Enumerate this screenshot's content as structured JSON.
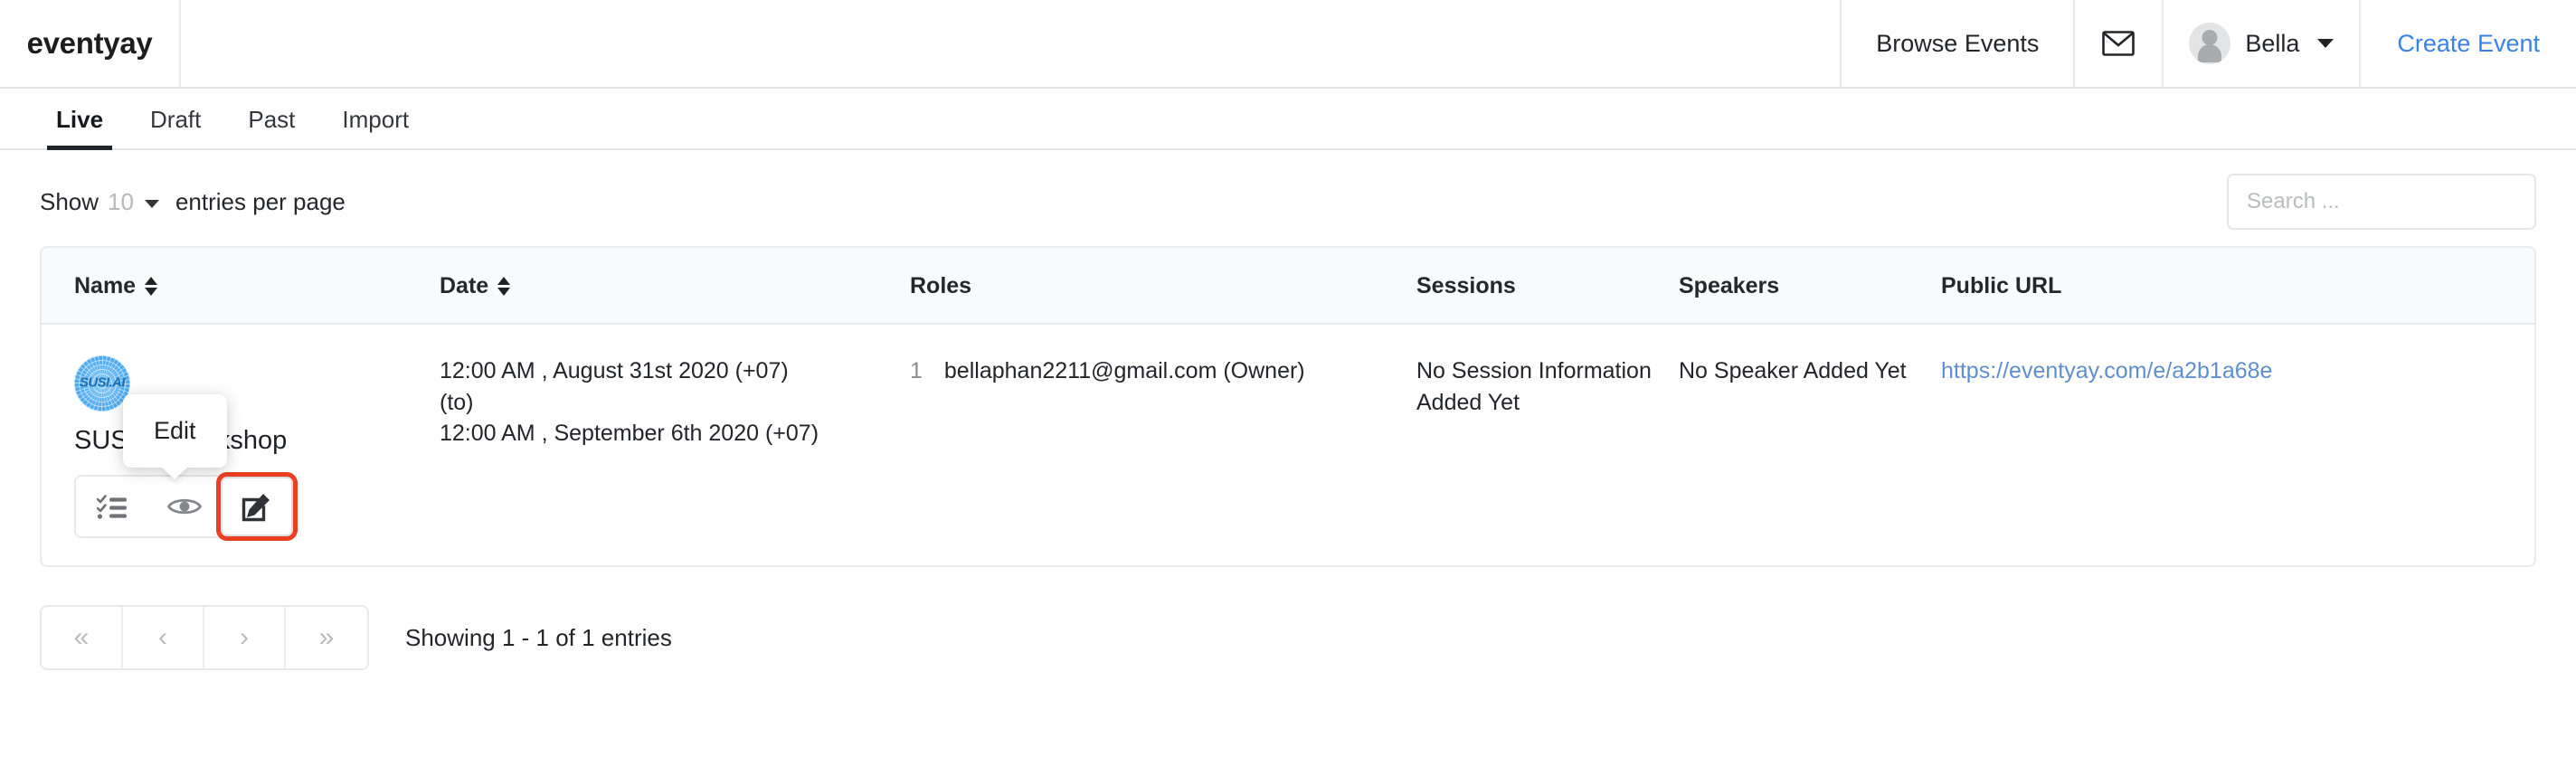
{
  "header": {
    "brand": "eventyay",
    "browse_events": "Browse Events",
    "mail_icon": "envelope-icon",
    "user_name": "Bella",
    "create_event": "Create Event"
  },
  "tabs": [
    {
      "label": "Live",
      "active": true
    },
    {
      "label": "Draft",
      "active": false
    },
    {
      "label": "Past",
      "active": false
    },
    {
      "label": "Import",
      "active": false
    }
  ],
  "controls": {
    "show_label": "Show",
    "entries_count": "10",
    "entries_suffix": "entries per page",
    "search_placeholder": "Search ...",
    "search_value": "",
    "search_icon": "search-icon"
  },
  "table": {
    "columns": [
      {
        "label": "Name",
        "sortable": true
      },
      {
        "label": "Date",
        "sortable": true
      },
      {
        "label": "Roles",
        "sortable": false
      },
      {
        "label": "Sessions",
        "sortable": false
      },
      {
        "label": "Speakers",
        "sortable": false
      },
      {
        "label": "Public URL",
        "sortable": false
      }
    ],
    "rows": [
      {
        "logo_text": "SUSI.AI",
        "name": "SUSI.AI workshop",
        "date_start": "12:00 AM , August 31st 2020 (+07)",
        "date_to": "(to)",
        "date_end": "12:00 AM , September 6th 2020 (+07)",
        "roles_count": "1",
        "roles_value": "bellaphan2211@gmail.com (Owner)",
        "sessions": "No Session Information Added Yet",
        "speakers": "No Speaker Added Yet",
        "public_url": "https://eventyay.com/e/a2b1a68e",
        "actions": [
          {
            "icon": "checklist-icon",
            "title": "Sessions"
          },
          {
            "icon": "eye-icon",
            "title": "View"
          },
          {
            "icon": "edit-icon",
            "title": "Edit"
          }
        ]
      }
    ]
  },
  "tooltip": {
    "text": "Edit"
  },
  "pagination": {
    "first": "«",
    "prev": "‹",
    "next": "›",
    "last": "»",
    "showing": "Showing 1 - 1 of 1 entries"
  },
  "colors": {
    "accent_blue": "#3b82e8",
    "link_blue": "#5f8ecd",
    "highlight_red": "#ea3f21",
    "logo_blue": "#48a7ee"
  }
}
